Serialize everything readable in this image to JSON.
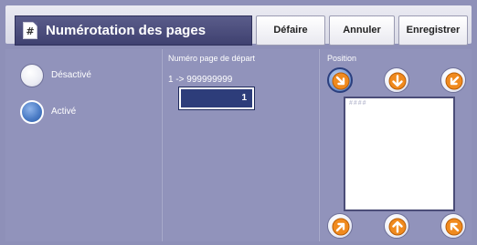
{
  "header": {
    "title": "Numérotation des pages",
    "buttons": {
      "undo": "Défaire",
      "cancel": "Annuler",
      "save": "Enregistrer"
    }
  },
  "options": {
    "off_label": "Désactivé",
    "on_label": "Activé",
    "selected": "on"
  },
  "start_page": {
    "label": "Numéro page de départ",
    "range": "1 -> 999999999",
    "value": "1"
  },
  "position": {
    "label": "Position",
    "selected": "top-left",
    "preview_text": "####",
    "arrows": [
      {
        "id": "top-left",
        "icon": "arrow-down-right-icon"
      },
      {
        "id": "top-center",
        "icon": "arrow-down-icon"
      },
      {
        "id": "top-right",
        "icon": "arrow-down-left-icon"
      },
      {
        "id": "bottom-left",
        "icon": "arrow-up-right-icon"
      },
      {
        "id": "bottom-center",
        "icon": "arrow-up-icon"
      },
      {
        "id": "bottom-right",
        "icon": "arrow-up-left-icon"
      }
    ]
  },
  "colors": {
    "background": "#8e90b8",
    "title_bar": "#45477a",
    "arrow_orange": "#f08a1e",
    "input_bg": "#2d3d7a"
  }
}
